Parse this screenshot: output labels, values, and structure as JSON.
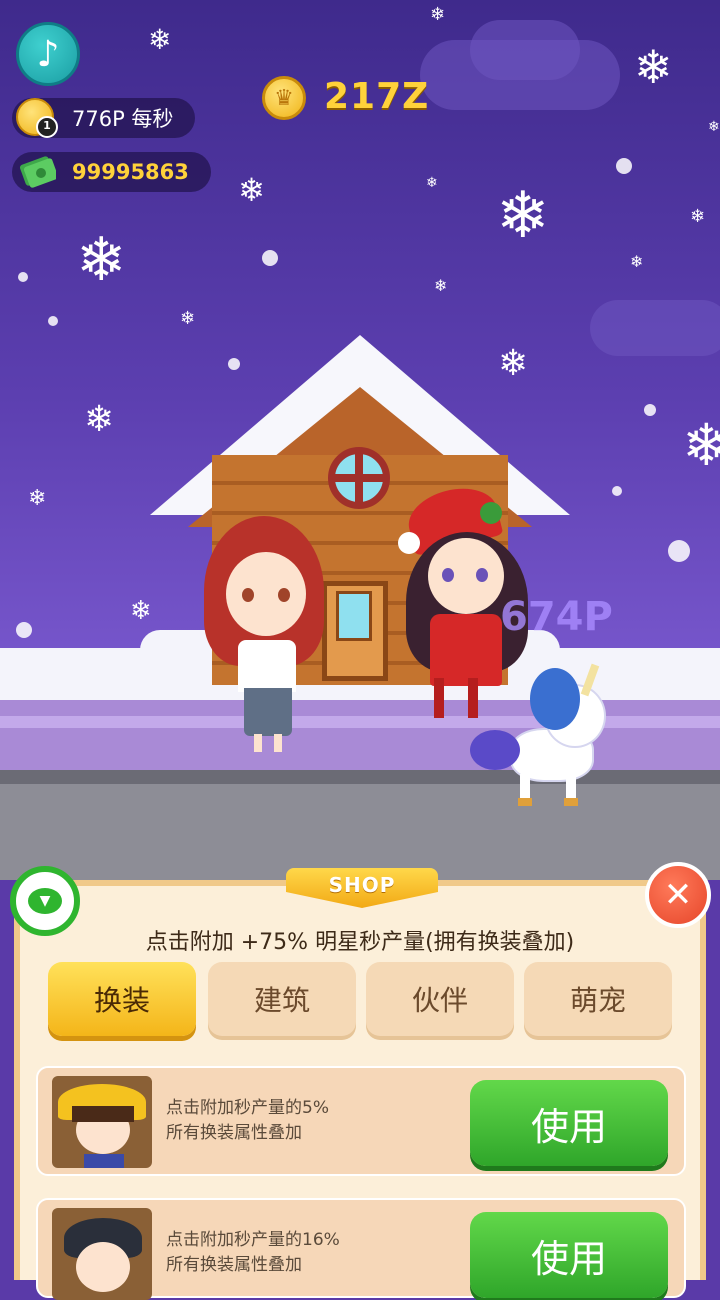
{
  "hud": {
    "music_icon": "music-note-icon",
    "per_second": "776P 每秒",
    "coin_badge": "1",
    "cash": "99995863",
    "top_total": "217Z"
  },
  "scene": {
    "floating_text": "674P"
  },
  "shop": {
    "tag": "SHOP",
    "bonus_text": "点击附加 +75% 明星秒产量(拥有换装叠加)",
    "tabs": [
      {
        "label": "换装",
        "active": true
      },
      {
        "label": "建筑",
        "active": false
      },
      {
        "label": "伙伴",
        "active": false
      },
      {
        "label": "萌宠",
        "active": false
      }
    ],
    "items": [
      {
        "line1": "点击附加秒产量的5%",
        "line2": "所有换装属性叠加",
        "button": "使用"
      },
      {
        "line1": "点击附加秒产量的16%",
        "line2": "所有换装属性叠加",
        "button": "使用"
      }
    ],
    "close_icon": "close-icon",
    "collapse_icon": "chat-collapse-icon"
  },
  "colors": {
    "sky": "#4a2f99",
    "gold": "#ffd23a",
    "green": "#2fa62a",
    "panel": "#fcefd9"
  }
}
